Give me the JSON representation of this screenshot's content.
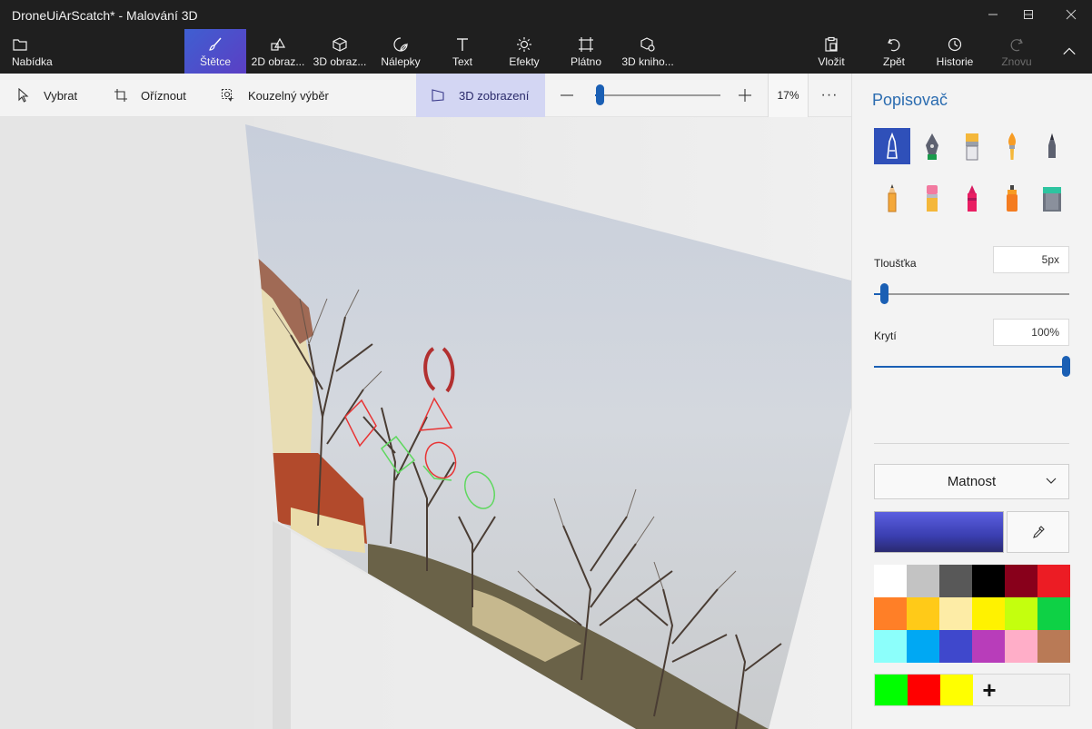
{
  "window": {
    "title": "DroneUiArScatch* - Malování 3D"
  },
  "ribbon": {
    "items": [
      {
        "label": "Nabídka",
        "icon": "folder-icon"
      },
      {
        "label": "Štětce",
        "icon": "brush-icon"
      },
      {
        "label": "2D obraz...",
        "icon": "2d-shapes-icon"
      },
      {
        "label": "3D obraz...",
        "icon": "3d-shapes-icon"
      },
      {
        "label": "Nálepky",
        "icon": "sticker-icon"
      },
      {
        "label": "Text",
        "icon": "text-icon"
      },
      {
        "label": "Efekty",
        "icon": "sun-icon"
      },
      {
        "label": "Plátno",
        "icon": "canvas-icon"
      },
      {
        "label": "3D kniho...",
        "icon": "3d-library-icon"
      }
    ],
    "right": [
      {
        "label": "Vložit",
        "icon": "paste-icon"
      },
      {
        "label": "Zpět",
        "icon": "undo-icon"
      },
      {
        "label": "Historie",
        "icon": "history-icon"
      },
      {
        "label": "Znovu",
        "icon": "redo-icon"
      }
    ],
    "active": "Štětce"
  },
  "toolbar": {
    "select": "Vybrat",
    "crop": "Oříznout",
    "magic_select": "Kouzelný výběr",
    "view3d": "3D zobrazení",
    "zoom_percent": "17%",
    "zoom_level": 0.17,
    "more": "···"
  },
  "panel": {
    "title": "Popisovač",
    "brushes": [
      "marker-icon",
      "calligraphy-pen-icon",
      "oil-brush-icon",
      "watercolor-icon",
      "pixel-pen-icon",
      "pencil-icon",
      "eraser-icon",
      "crayon-icon",
      "spray-can-icon",
      "fill-bucket-icon"
    ],
    "thickness_label": "Tloušťka",
    "thickness_value": "5px",
    "thickness_level": 0.05,
    "opacity_label": "Krytí",
    "opacity_value": "100%",
    "opacity_level": 1.0,
    "finish": "Matnost",
    "current_color": "#4b4fd0",
    "palette": [
      "#ffffff",
      "#c3c3c3",
      "#585858",
      "#000000",
      "#88001b",
      "#ec1c24",
      "#ff7f27",
      "#ffca18",
      "#fdeca6",
      "#fff200",
      "#c4ff0e",
      "#0ed145",
      "#8cfffb",
      "#00a8f3",
      "#3f48cc",
      "#b83dba",
      "#ffaec8",
      "#b97a56"
    ],
    "custom_colors": [
      "#00ff00",
      "#ff0000",
      "#ffff00"
    ],
    "add_color": "+"
  },
  "colors": {
    "accent": "#1a5fb4",
    "ribbon_bg": "#1f1f1f",
    "active_tab": "#4a4fd0"
  }
}
